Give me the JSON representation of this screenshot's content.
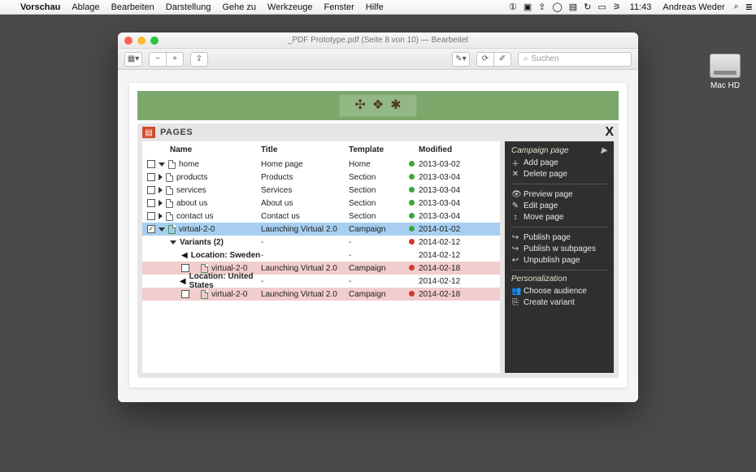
{
  "menubar": {
    "app": "Vorschau",
    "items": [
      "Ablage",
      "Bearbeiten",
      "Darstellung",
      "Gehe zu",
      "Werkzeuge",
      "Fenster",
      "Hilfe"
    ],
    "clock": "11:43",
    "user": "Andreas Weder"
  },
  "desktop": {
    "mac_hd": "Mac HD"
  },
  "window": {
    "title": "_PDF Prototype.pdf (Seite 8 von 10) — Bearbeitet",
    "search_placeholder": "Suchen"
  },
  "pages_panel": {
    "label": "PAGES",
    "headers": {
      "name": "Name",
      "title": "Title",
      "template": "Template",
      "modified": "Modified"
    },
    "rows": [
      {
        "indent": 0,
        "checkbox": "empty",
        "expander": "down",
        "icon": "doc",
        "name": "home",
        "title": "Home page",
        "template": "Home",
        "status": "green",
        "modified": "2013-03-02"
      },
      {
        "indent": 0,
        "checkbox": "empty",
        "expander": "right",
        "icon": "doc",
        "name": "products",
        "title": "Products",
        "template": "Section",
        "status": "green",
        "modified": "2013-03-04"
      },
      {
        "indent": 0,
        "checkbox": "empty",
        "expander": "right",
        "icon": "doc",
        "name": "services",
        "title": "Services",
        "template": "Section",
        "status": "green",
        "modified": "2013-03-04"
      },
      {
        "indent": 0,
        "checkbox": "empty",
        "expander": "right",
        "icon": "doc",
        "name": "about us",
        "title": "About us",
        "template": "Section",
        "status": "green",
        "modified": "2013-03-04"
      },
      {
        "indent": 0,
        "checkbox": "empty",
        "expander": "right",
        "icon": "doc",
        "name": "contact us",
        "title": "Contact us",
        "template": "Section",
        "status": "green",
        "modified": "2013-03-04"
      },
      {
        "indent": 0,
        "checkbox": "checked",
        "expander": "down",
        "icon": "doc-green",
        "name": "virtual-2-0",
        "title": "Launching Virtual 2.0",
        "template": "Campaign",
        "status": "green",
        "modified": "2014-01-02",
        "selected": true
      },
      {
        "indent": 1,
        "checkbox": "",
        "expander": "down",
        "icon": "",
        "name": "Variants (2)",
        "title": "-",
        "template": "-",
        "status": "red",
        "modified": "2014-02-12"
      },
      {
        "indent": 2,
        "checkbox": "",
        "expander": "flag",
        "icon": "",
        "name": "Location: Sweden",
        "title": "-",
        "template": "-",
        "status": "",
        "modified": "2014-02-12"
      },
      {
        "indent": 3,
        "checkbox": "empty",
        "expander": "",
        "icon": "doc-green",
        "name": "virtual-2-0",
        "title": "Launching Virtual 2.0",
        "template": "Campaign",
        "status": "red",
        "modified": "2014-02-18",
        "pink": true
      },
      {
        "indent": 2,
        "checkbox": "",
        "expander": "flag",
        "icon": "",
        "name": "Location: United States",
        "title": "-",
        "template": "-",
        "status": "",
        "modified": "2014-02-12"
      },
      {
        "indent": 3,
        "checkbox": "empty",
        "expander": "",
        "icon": "doc-green",
        "name": "virtual-2-0",
        "title": "Launching Virtual 2.0",
        "template": "Campaign",
        "status": "red",
        "modified": "2014-02-18",
        "pink": true
      }
    ]
  },
  "sidebar": {
    "title": "Campaign page",
    "group1": [
      {
        "icon": "＋",
        "label": "Add page"
      },
      {
        "icon": "✕",
        "label": "Delete page"
      }
    ],
    "group2": [
      {
        "icon": "👁",
        "label": "Preview page"
      },
      {
        "icon": "✎",
        "label": "Edit page"
      },
      {
        "icon": "↕",
        "label": "Move page"
      }
    ],
    "group3": [
      {
        "icon": "↪",
        "label": "Publish page"
      },
      {
        "icon": "↪",
        "label": "Publish w subpages"
      },
      {
        "icon": "↩",
        "label": "Unpublish page"
      }
    ],
    "personalization_label": "Personalization",
    "group4": [
      {
        "icon": "👥",
        "label": "Choose audience"
      },
      {
        "icon": "⎘",
        "label": "Create variant"
      }
    ]
  }
}
